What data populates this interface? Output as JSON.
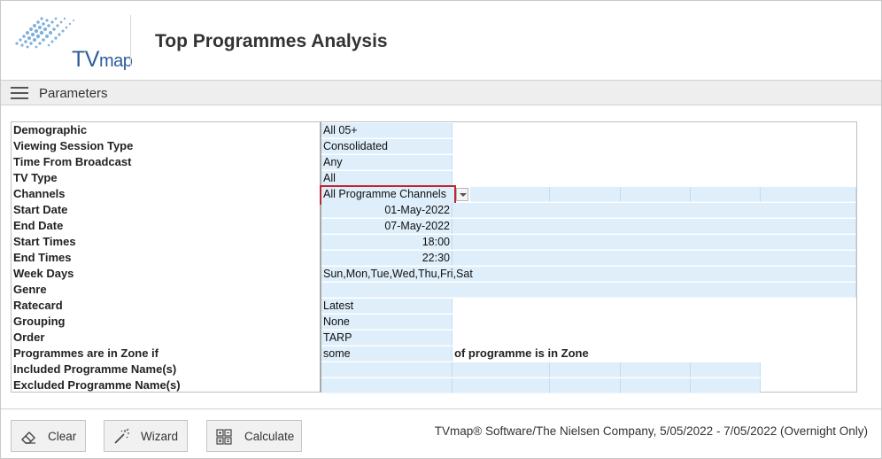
{
  "app": {
    "logo_text": "TV",
    "logo_text_small": "map",
    "title": "Top Programmes Analysis"
  },
  "params_bar": {
    "title": "Parameters",
    "menu_icon": "hamburger-menu-icon"
  },
  "parameters": {
    "labels": [
      "Demographic",
      "Viewing Session Type",
      "Time From Broadcast",
      "TV Type",
      "Channels",
      "Start Date",
      "End Date",
      "Start Times",
      "End Times",
      "Week Days",
      "Genre",
      "Ratecard",
      "Grouping",
      "Order",
      "Programmes are in Zone if",
      "Included Programme Name(s)",
      "Excluded Programme Name(s)"
    ],
    "demographic": "All 05+",
    "viewing_session_type": "Consolidated",
    "time_from_broadcast": "Any",
    "tv_type": "All",
    "channels": "All Programme Channels",
    "start_date": "01-May-2022",
    "end_date": "07-May-2022",
    "start_times": "18:00",
    "end_times": "22:30",
    "week_days": "Sun,Mon,Tue,Wed,Thu,Fri,Sat",
    "genre": "",
    "ratecard": "Latest",
    "grouping": "None",
    "order": "TARP",
    "zone_condition": "some",
    "zone_note": "of programme is in Zone"
  },
  "footer": {
    "clear_label": "Clear",
    "wizard_label": "Wizard",
    "calculate_label": "Calculate",
    "info": "TVmap® Software/The Nielsen Company, 5/05/2022 - 7/05/2022 (Overnight Only)"
  },
  "colors": {
    "cell_bg": "#deeefa",
    "highlight": "#c0272d",
    "brand": "#2c5d9a"
  }
}
